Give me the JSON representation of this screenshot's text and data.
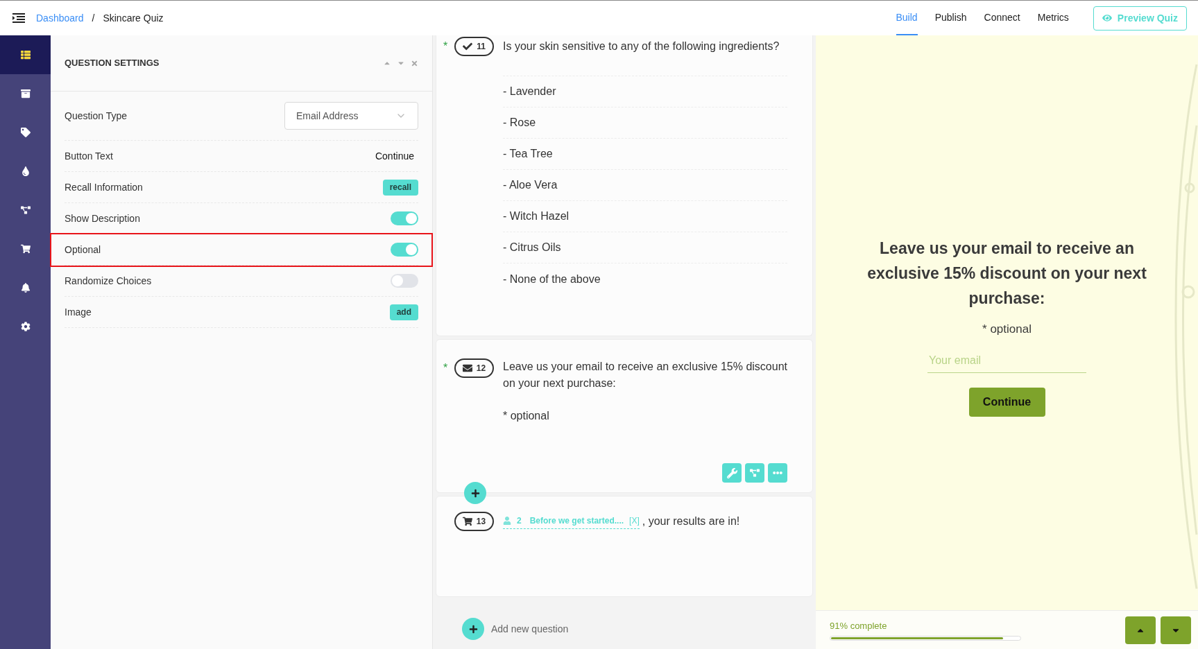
{
  "breadcrumb": {
    "link": "Dashboard",
    "separator": "/",
    "current": "Skincare Quiz"
  },
  "nav_tabs": [
    {
      "label": "Build",
      "selected": true
    },
    {
      "label": "Publish",
      "selected": false
    },
    {
      "label": "Connect",
      "selected": false
    },
    {
      "label": "Metrics",
      "selected": false
    }
  ],
  "preview_button": "Preview Quiz",
  "sidebar": {
    "items": [
      {
        "selected": true
      },
      {
        "selected": false
      },
      {
        "selected": false
      },
      {
        "selected": false
      },
      {
        "selected": false
      },
      {
        "selected": false
      },
      {
        "selected": false
      },
      {
        "selected": false
      }
    ]
  },
  "settings": {
    "title": "QUESTION SETTINGS",
    "rows": [
      {
        "kind": "select",
        "label": "Question Type",
        "value": "Email Address",
        "highlighted": false
      },
      {
        "kind": "text",
        "label": "Button Text",
        "value": "Continue",
        "highlighted": false
      },
      {
        "kind": "button",
        "label": "Recall Information",
        "value": "recall",
        "highlighted": false
      },
      {
        "kind": "toggle",
        "label": "Show Description",
        "on": true,
        "highlighted": false
      },
      {
        "kind": "toggle",
        "label": "Optional",
        "on": true,
        "highlighted": true
      },
      {
        "kind": "toggle",
        "label": "Randomize Choices",
        "on": false,
        "highlighted": false
      },
      {
        "kind": "button",
        "label": "Image",
        "value": "add",
        "highlighted": false
      }
    ]
  },
  "questions": [
    {
      "kind": "choice",
      "number": "11",
      "required_mark": "*",
      "text": "Is your skin sensitive to any of the following ingredients?",
      "options": [
        "- Lavender",
        "- Rose",
        "- Tea Tree",
        "- Aloe Vera",
        "- Witch Hazel",
        "- Citrus Oils",
        "- None of the above"
      ]
    },
    {
      "kind": "email",
      "number": "12",
      "required_mark": "*",
      "text": "Leave us your email to receive an exclusive 15% discount on your next purchase:",
      "description": "* optional"
    },
    {
      "kind": "product",
      "number": "13",
      "recall": {
        "number": "2",
        "title": "Before we get started....",
        "remove": "[X]"
      },
      "text": ", your results are in!"
    }
  ],
  "add_question": "Add new question",
  "preview": {
    "heading": "Leave us your email to receive an exclusive 15% discount on your next purchase:",
    "description": "* optional",
    "email_placeholder": "Your email",
    "button": "Continue",
    "progress_text": "91% complete",
    "level": 0.91
  }
}
